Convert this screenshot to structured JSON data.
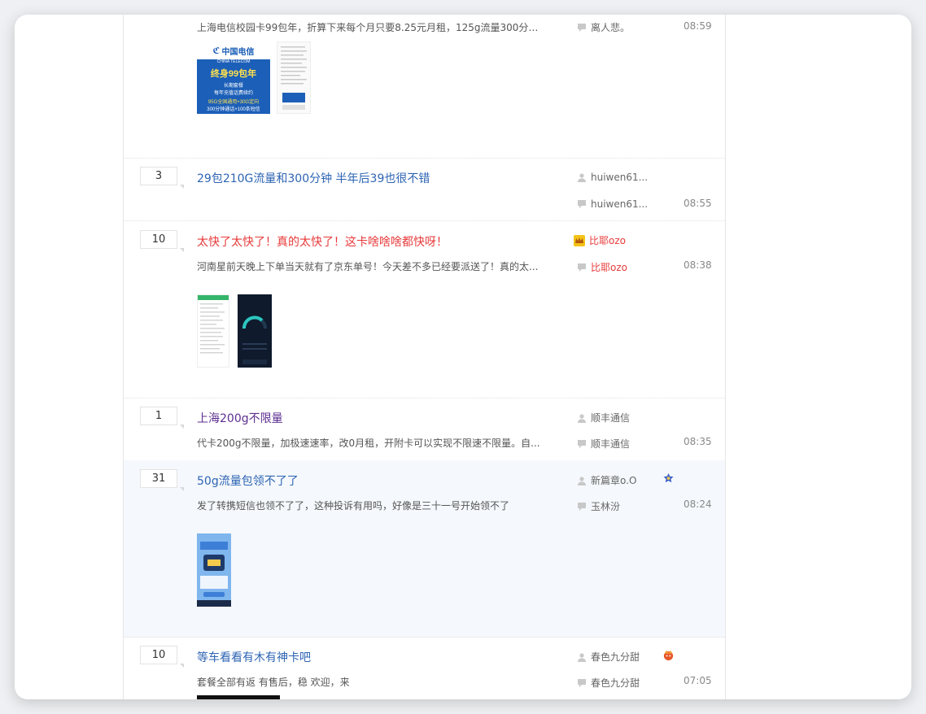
{
  "threads": [
    {
      "excerpt": "上海电信校园卡99包年，折算下来每个月只要8.25元月租，125g流量300分钟...",
      "last_reply_user": "离人悲。",
      "time": "08:59",
      "promo": {
        "brand": "中国电信",
        "brand_en": "CHINA TELECOM",
        "line1": "终身99包年",
        "line2": "长期套餐",
        "line3": "每年充值话费续约",
        "line4": "95G全国通用+30G定向",
        "line5": "300分钟通话+100条短信"
      }
    },
    {
      "count": "3",
      "title": "29包210G流量和300分钟 半年后39也很不错",
      "author": "huiwen61...",
      "last_reply_user": "huiwen61...",
      "time": "08:55"
    },
    {
      "count": "10",
      "title": "太快了太快了！真的太快了！这卡啥啥啥都快呀！",
      "author": "比耶ozo",
      "excerpt": "河南星前天晚上下单当天就有了京东单号！今天差不多已经要派送了！真的太...",
      "last_reply_user": "比耶ozo",
      "time": "08:38"
    },
    {
      "count": "1",
      "title": "上海200g不限量",
      "author": "顺丰通信",
      "excerpt": "代卡200g不限量，加极速速率，改0月租，开附卡可以实现不限速不限量。自...",
      "last_reply_user": "顺丰通信",
      "time": "08:35"
    },
    {
      "count": "31",
      "title": "50g流量包领不了了",
      "author": "新篇章o.O",
      "excerpt": "发了转携短信也领不了了，这种投诉有用吗，好像是三十一号开始领不了",
      "last_reply_user": "玉林汾",
      "time": "08:24"
    },
    {
      "count": "10",
      "title": "等车看看有木有神卡吧",
      "author": "春色九分甜",
      "excerpt": "套餐全部有返 有售后，稳 欢迎，来",
      "last_reply_user": "春色九分甜",
      "time": "07:05"
    }
  ],
  "icons": {
    "author": "person-icon",
    "reply": "speech-bubble-icon",
    "vip": "crown-badge-icon",
    "medal": "star-medal-icon"
  },
  "colors": {
    "link_blue": "#2d64b3",
    "hot_red": "#e83a3a",
    "visited_purple": "#5d2e91",
    "highlight_row": "#f5f8fc"
  }
}
